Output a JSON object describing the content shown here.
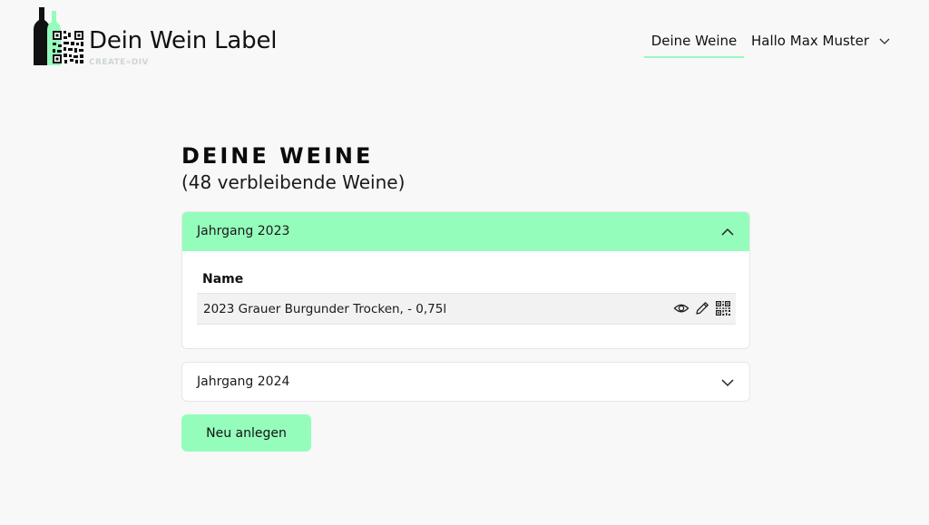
{
  "header": {
    "logo_title": "Dein Wein Label",
    "logo_subtitle": "CREATE»DIV",
    "nav_link": "Deine Weine",
    "user_menu": "Hallo Max Muster"
  },
  "main": {
    "title": "DEINE WEINE",
    "subtitle": "(48 verbleibende Weine)",
    "accordions": [
      {
        "label": "Jahrgang 2023",
        "expanded": true,
        "column_header": "Name",
        "rows": [
          {
            "name": "2023 Grauer Burgunder Trocken, - 0,75l"
          }
        ]
      },
      {
        "label": "Jahrgang 2024",
        "expanded": false
      }
    ],
    "new_button": "Neu anlegen"
  },
  "colors": {
    "accent": "#95fdbb",
    "background": "#f8f8f8"
  },
  "icons": [
    "wine-bottle-logo-icon",
    "qr-code-icon",
    "chevron-down-icon",
    "chevron-up-icon",
    "eye-icon",
    "pencil-icon"
  ]
}
